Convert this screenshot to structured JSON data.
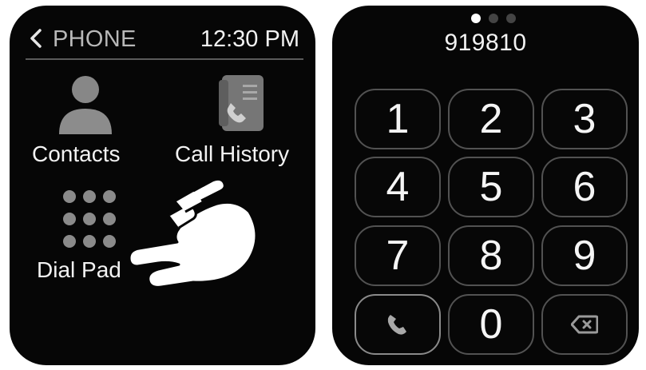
{
  "left_screen": {
    "header": {
      "back_icon": "chevron-left-icon",
      "title": "PHONE",
      "time": "12:30 PM"
    },
    "apps": [
      {
        "label": "Contacts",
        "icon": "person-icon"
      },
      {
        "label": "Call History",
        "icon": "call-log-icon"
      },
      {
        "label": "Dial Pad",
        "icon": "dialpad-icon"
      }
    ],
    "overlay_icon": "pointing-hand-icon"
  },
  "right_screen": {
    "page_indicator": {
      "count": 3,
      "active_index": 0
    },
    "dialed_number": "919810",
    "keys": [
      "1",
      "2",
      "3",
      "4",
      "5",
      "6",
      "7",
      "8",
      "9"
    ],
    "bottom_row": {
      "call_icon": "phone-icon",
      "zero": "0",
      "delete_icon": "backspace-icon"
    }
  },
  "colors": {
    "screen_background": "#060606",
    "text_primary": "#f2f2f2",
    "text_secondary": "#b8b8b8",
    "key_border": "#525252",
    "icon_gray": "#8c8c8c"
  }
}
